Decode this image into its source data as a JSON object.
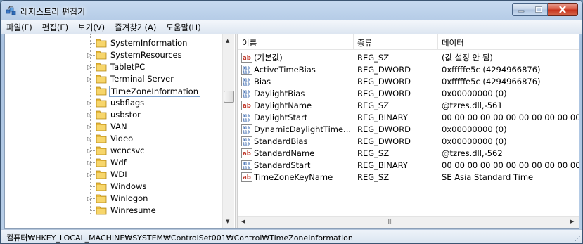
{
  "window": {
    "title": "레지스트리 편집기"
  },
  "menu": [
    "파일(F)",
    "편집(E)",
    "보기(V)",
    "즐겨찾기(A)",
    "도움말(H)"
  ],
  "tree": {
    "items": [
      {
        "label": "SystemInformation",
        "expandable": false,
        "selected": false
      },
      {
        "label": "SystemResources",
        "expandable": true,
        "selected": false
      },
      {
        "label": "TabletPC",
        "expandable": true,
        "selected": false
      },
      {
        "label": "Terminal Server",
        "expandable": true,
        "selected": false
      },
      {
        "label": "TimeZoneInformation",
        "expandable": false,
        "selected": true
      },
      {
        "label": "usbflags",
        "expandable": true,
        "selected": false
      },
      {
        "label": "usbstor",
        "expandable": true,
        "selected": false
      },
      {
        "label": "VAN",
        "expandable": true,
        "selected": false
      },
      {
        "label": "Video",
        "expandable": true,
        "selected": false
      },
      {
        "label": "wcncsvc",
        "expandable": true,
        "selected": false
      },
      {
        "label": "Wdf",
        "expandable": true,
        "selected": false
      },
      {
        "label": "WDI",
        "expandable": true,
        "selected": false
      },
      {
        "label": "Windows",
        "expandable": false,
        "selected": false
      },
      {
        "label": "Winlogon",
        "expandable": true,
        "selected": false
      },
      {
        "label": "Winresume",
        "expandable": false,
        "selected": false
      }
    ]
  },
  "list": {
    "columns": [
      "이름",
      "종류",
      "데이터"
    ],
    "rows": [
      {
        "icon": "string-value-icon",
        "name": "(기본값)",
        "type": "REG_SZ",
        "data": "(값 설정 안 됨)"
      },
      {
        "icon": "binary-value-icon",
        "name": "ActiveTimeBias",
        "type": "REG_DWORD",
        "data": "0xfffffe5c (4294966876)"
      },
      {
        "icon": "binary-value-icon",
        "name": "Bias",
        "type": "REG_DWORD",
        "data": "0xfffffe5c (4294966876)"
      },
      {
        "icon": "binary-value-icon",
        "name": "DaylightBias",
        "type": "REG_DWORD",
        "data": "0x00000000 (0)"
      },
      {
        "icon": "string-value-icon",
        "name": "DaylightName",
        "type": "REG_SZ",
        "data": "@tzres.dll,-561"
      },
      {
        "icon": "binary-value-icon",
        "name": "DaylightStart",
        "type": "REG_BINARY",
        "data": "00 00 00 00 00 00 00 00 00 00 00"
      },
      {
        "icon": "binary-value-icon",
        "name": "DynamicDaylightTime...",
        "type": "REG_DWORD",
        "data": "0x00000000 (0)"
      },
      {
        "icon": "binary-value-icon",
        "name": "StandardBias",
        "type": "REG_DWORD",
        "data": "0x00000000 (0)"
      },
      {
        "icon": "string-value-icon",
        "name": "StandardName",
        "type": "REG_SZ",
        "data": "@tzres.dll,-562"
      },
      {
        "icon": "binary-value-icon",
        "name": "StandardStart",
        "type": "REG_BINARY",
        "data": "00 00 00 00 00 00 00 00 00 00 00"
      },
      {
        "icon": "string-value-icon",
        "name": "TimeZoneKeyName",
        "type": "REG_SZ",
        "data": "SE Asia Standard Time"
      }
    ]
  },
  "status": {
    "path": "컴퓨터₩HKEY_LOCAL_MACHINE₩SYSTEM₩ControlSet001₩Control₩TimeZoneInformation"
  },
  "colors": {
    "folder": "#e8b93a",
    "selection_border": "#7da2ce",
    "string_icon": "#c0392b",
    "binary_icon": "#2f5fa8"
  }
}
